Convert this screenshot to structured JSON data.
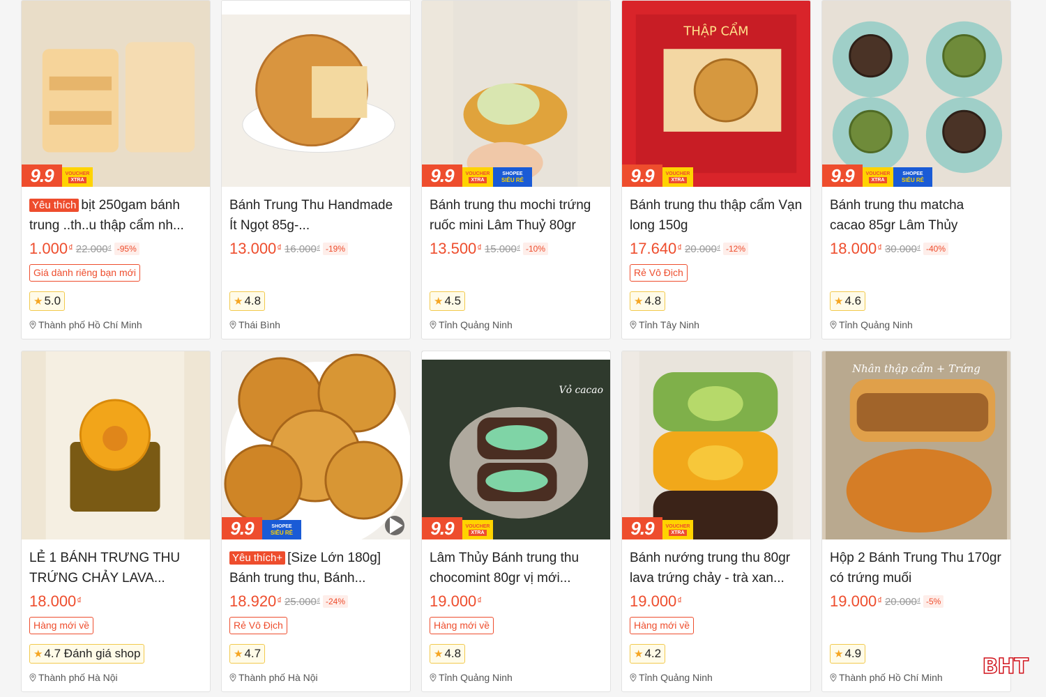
{
  "colors": {
    "accent": "#ee4d2d",
    "star": "#f5a623",
    "voucher_yellow": "#ffd300",
    "shopee_blue": "#1a5bd6"
  },
  "badge_text": {
    "sale": "9.9",
    "voucher_top": "VOUCHER",
    "voucher_bottom": "XTRA",
    "shopee_top": "SHOPEE",
    "shopee_bottom": "SIÊU RẺ"
  },
  "currency": "₫",
  "watermark": "BHT",
  "products": [
    {
      "tag": "Yêu thích",
      "title": "bịt 250gam bánh trung ..th..u thập cẩm nh...",
      "price": "1.000",
      "old_price": "22.000",
      "discount": "-95%",
      "promo": "Giá dành riêng bạn mới",
      "rating": "5.0",
      "location": "Thành phố Hồ Chí Minh",
      "badge": "voucher",
      "image_icon": "mooncake-pack-image"
    },
    {
      "tag": "",
      "title": "Bánh Trung Thu Handmade Ít Ngọt 85g-...",
      "price": "13.000",
      "old_price": "16.000",
      "discount": "-19%",
      "promo": "",
      "rating": "4.8",
      "location": "Thái Bình",
      "badge": "none",
      "image_icon": "mooncake-cut-image"
    },
    {
      "tag": "",
      "title": "Bánh trung thu mochi trứng ruốc mini Lâm Thuỷ 80gr",
      "price": "13.500",
      "old_price": "15.000",
      "discount": "-10%",
      "promo": "",
      "rating": "4.5",
      "location": "Tỉnh Quảng Ninh",
      "badge": "voucher+shopee",
      "image_icon": "mooncake-mochi-image"
    },
    {
      "tag": "",
      "title": "Bánh trung thu thập cẩm Vạn long 150g",
      "price": "17.640",
      "old_price": "20.000",
      "discount": "-12%",
      "promo": "Rẻ Vô Địch",
      "rating": "4.8",
      "location": "Tỉnh Tây Ninh",
      "badge": "voucher",
      "image_icon": "mooncake-box-image"
    },
    {
      "tag": "",
      "title": "Bánh trung thu matcha cacao 85gr Lâm Thủy",
      "price": "18.000",
      "old_price": "30.000",
      "discount": "-40%",
      "promo": "",
      "rating": "4.6",
      "location": "Tỉnh Quảng Ninh",
      "badge": "voucher+shopee",
      "image_icon": "mooncake-plates-image"
    },
    {
      "tag": "",
      "title": "LẺ 1 BÁNH TRƯNG THU TRỨNG CHẢY LAVA...",
      "price": "18.000",
      "old_price": "",
      "discount": "",
      "promo": "Hàng mới về",
      "rating": "4.7 Đánh giá shop",
      "location": "Thành phố Hà Nội",
      "badge": "none",
      "image_icon": "mooncake-lava-image"
    },
    {
      "tag": "Yêu thích+",
      "title": "[Size Lớn 180g] Bánh trung thu, Bánh...",
      "price": "18.920",
      "old_price": "25.000",
      "discount": "-24%",
      "promo": "Rẻ Vô Địch",
      "rating": "4.7",
      "location": "Thành phố Hà Nội",
      "badge": "shopee",
      "image_icon": "mooncake-plate-image"
    },
    {
      "tag": "",
      "title": "Lâm Thủy Bánh trung thu chocomint 80gr vị mới...",
      "price": "19.000",
      "old_price": "",
      "discount": "",
      "promo": "Hàng mới về",
      "rating": "4.8",
      "location": "Tỉnh Quảng Ninh",
      "badge": "voucher",
      "image_icon": "mooncake-chocomint-image",
      "image_caption": "Vỏ cacao"
    },
    {
      "tag": "",
      "title": "Bánh nướng trung thu 80gr lava trứng chảy - trà xan...",
      "price": "19.000",
      "old_price": "",
      "discount": "",
      "promo": "Hàng mới về",
      "rating": "4.2",
      "location": "Tỉnh Quảng Ninh",
      "badge": "voucher",
      "image_icon": "mooncake-stack-image"
    },
    {
      "tag": "",
      "title": "Hộp 2 Bánh Trung Thu 170gr có trứng muối",
      "price": "19.000",
      "old_price": "20.000",
      "discount": "-5%",
      "promo": "",
      "rating": "4.9",
      "location": "Thành phố Hồ Chí Minh",
      "badge": "none",
      "image_icon": "mooncake-hand-image",
      "image_caption": "Nhân thập cẩm + Trứng"
    }
  ]
}
